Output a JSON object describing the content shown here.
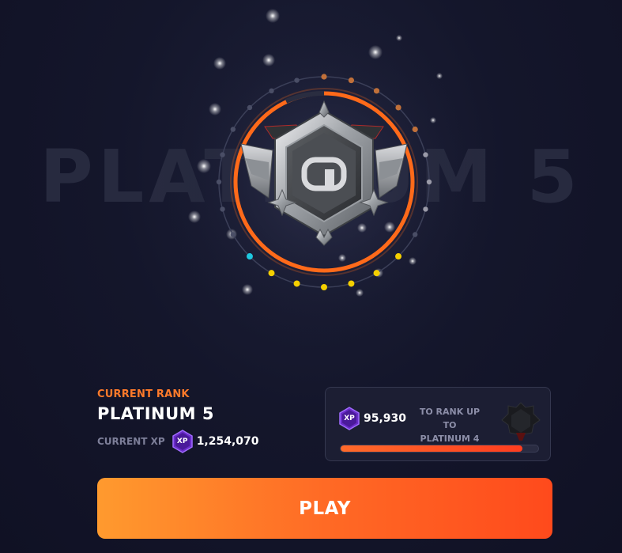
{
  "background_rank_text": "PLATINUM 5",
  "current_rank": {
    "label": "CURRENT RANK",
    "name": "PLATINUM 5",
    "xp_label": "CURRENT XP",
    "xp_badge": "XP",
    "xp_value": "1,254,070"
  },
  "next_rank": {
    "xp_badge": "XP",
    "xp_needed": "95,930",
    "to_rank_up_label": "TO RANK UP TO",
    "name": "PLATINUM 4",
    "progress_fraction": 0.92
  },
  "emblem": {
    "letter": "a",
    "icon": "platinum-rank-emblem"
  },
  "play_button": {
    "label": "PLAY"
  },
  "colors": {
    "accent": "#ff7a2a",
    "xp_purple": "#6a2cc9",
    "ring_orange": "#ff6a1a",
    "dot_yellow": "#f5d000",
    "dot_cyan": "#1ec8e0",
    "dot_bronze": "#c0703a"
  }
}
